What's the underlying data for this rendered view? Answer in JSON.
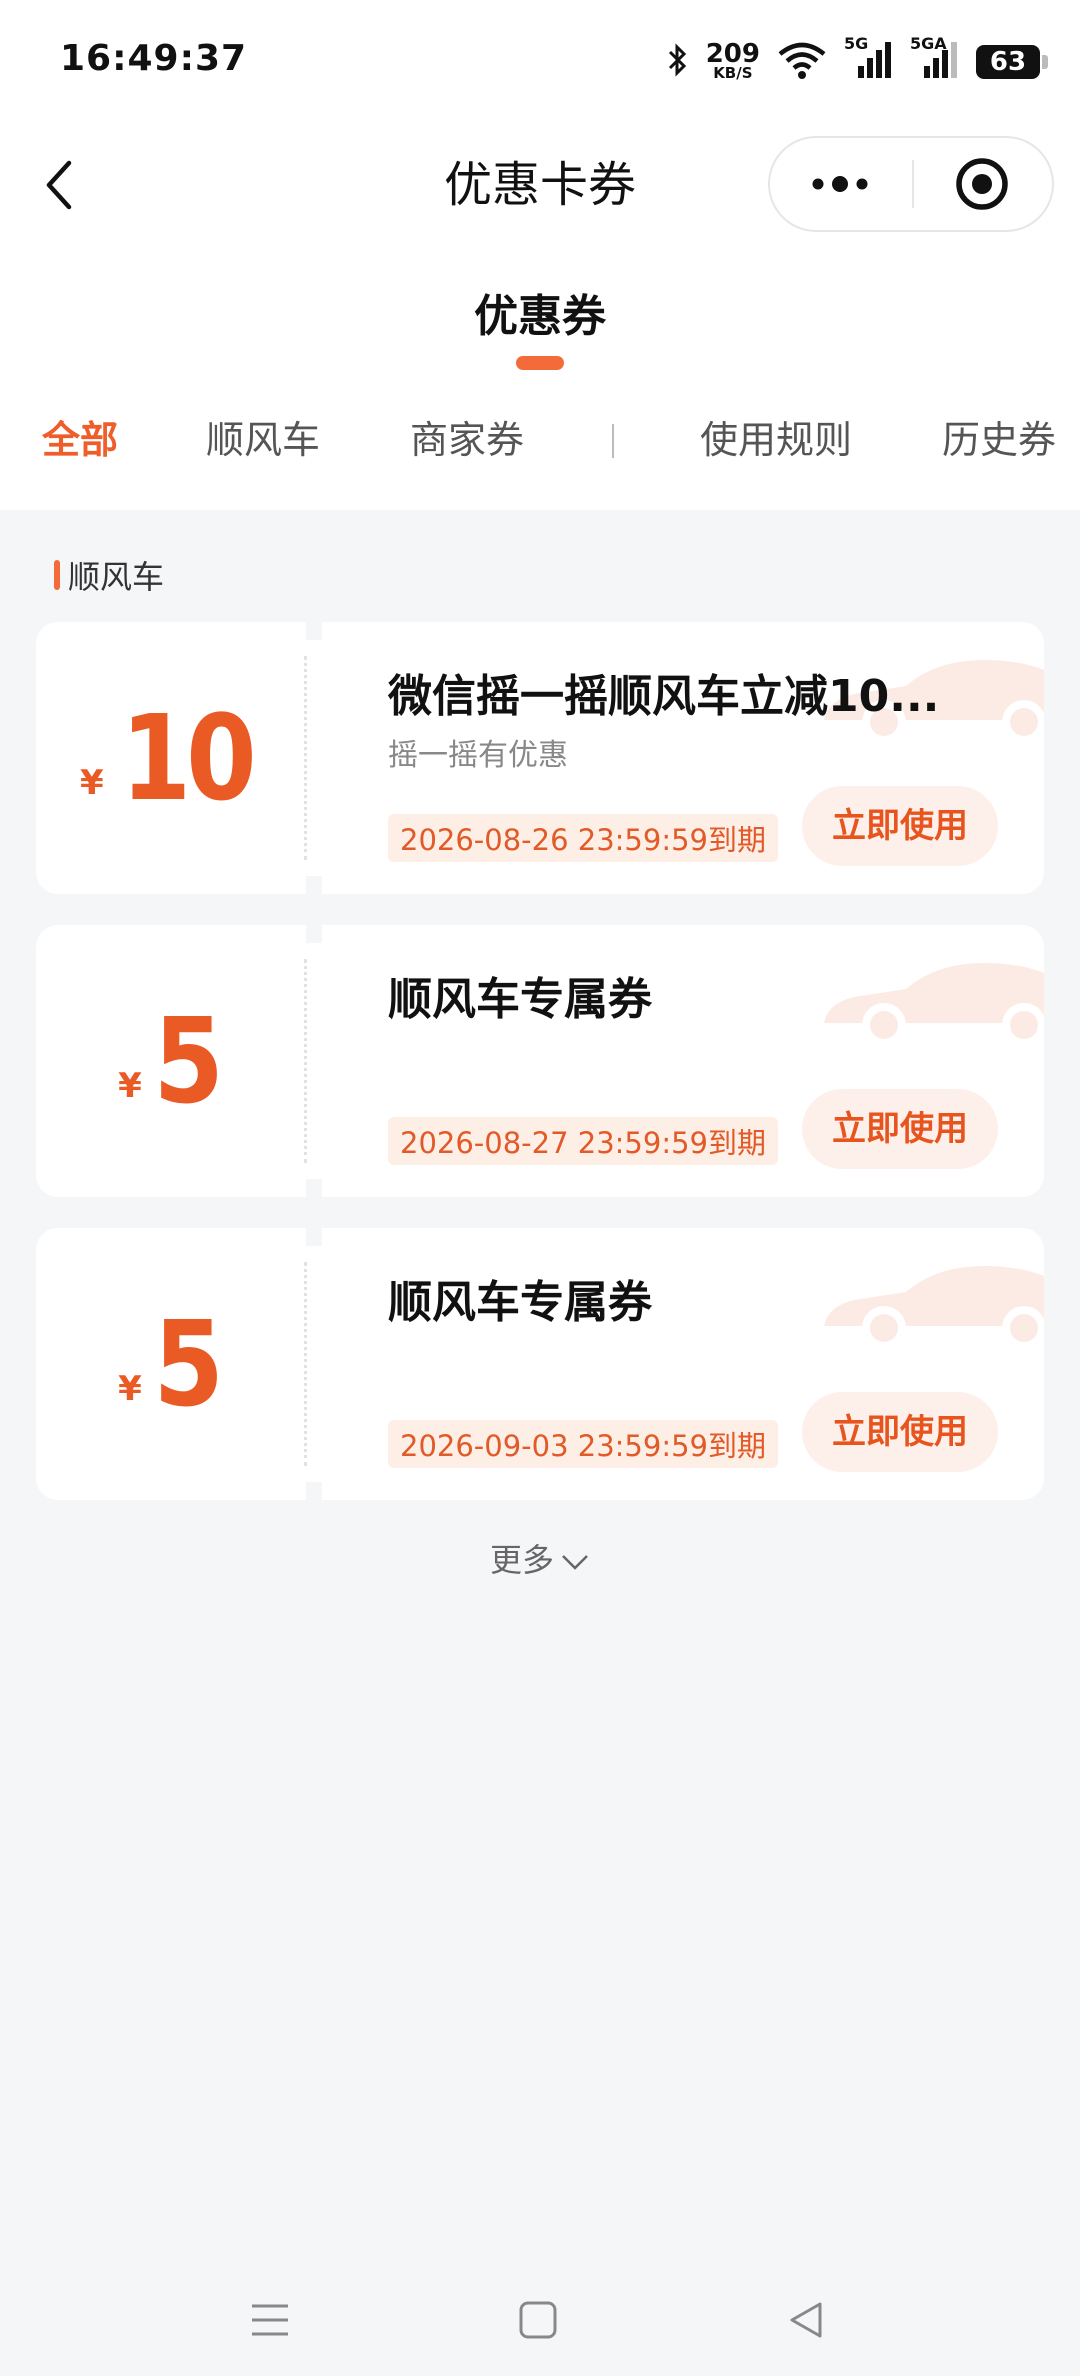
{
  "status_bar": {
    "time": "16:49:37",
    "net_speed_value": "209",
    "net_speed_unit": "KB/S",
    "signal_1_label": "5G",
    "signal_2_label": "5GA",
    "battery": "63",
    "icons": [
      "bluetooth-icon",
      "wifi-icon",
      "cellular-signal-icon",
      "battery-icon"
    ]
  },
  "nav": {
    "title": "优惠卡券",
    "icons": [
      "back-arrow-icon",
      "more-dots-icon",
      "close-target-icon"
    ]
  },
  "subtitle": "优惠券",
  "tabs": [
    {
      "label": "全部",
      "active": true
    },
    {
      "label": "顺风车",
      "active": false
    },
    {
      "label": "商家券",
      "active": false
    },
    {
      "label": "使用规则",
      "active": false
    },
    {
      "label": "历史券",
      "active": false
    }
  ],
  "section": {
    "label": "顺风车"
  },
  "coupons": [
    {
      "currency": "¥",
      "amount": "10",
      "name": "微信摇一摇顺风车立减10...",
      "desc": "摇一摇有优惠",
      "expiry": "2026-08-26 23:59:59到期",
      "button": "立即使用"
    },
    {
      "currency": "¥",
      "amount": "5",
      "name": "顺风车专属券",
      "desc": "",
      "expiry": "2026-08-27 23:59:59到期",
      "button": "立即使用"
    },
    {
      "currency": "¥",
      "amount": "5",
      "name": "顺风车专属券",
      "desc": "",
      "expiry": "2026-09-03 23:59:59到期",
      "button": "立即使用"
    }
  ],
  "more": {
    "label": "更多",
    "icon": "chevron-down-icon"
  },
  "system_nav": {
    "icons": [
      "menu-icon",
      "home-square-icon",
      "back-triangle-icon"
    ]
  },
  "colors": {
    "accent": "#ee5d2a",
    "page_bg": "#f5f6f8",
    "expiry_bg": "#fdeee6",
    "button_bg": "#fdf0ea"
  }
}
